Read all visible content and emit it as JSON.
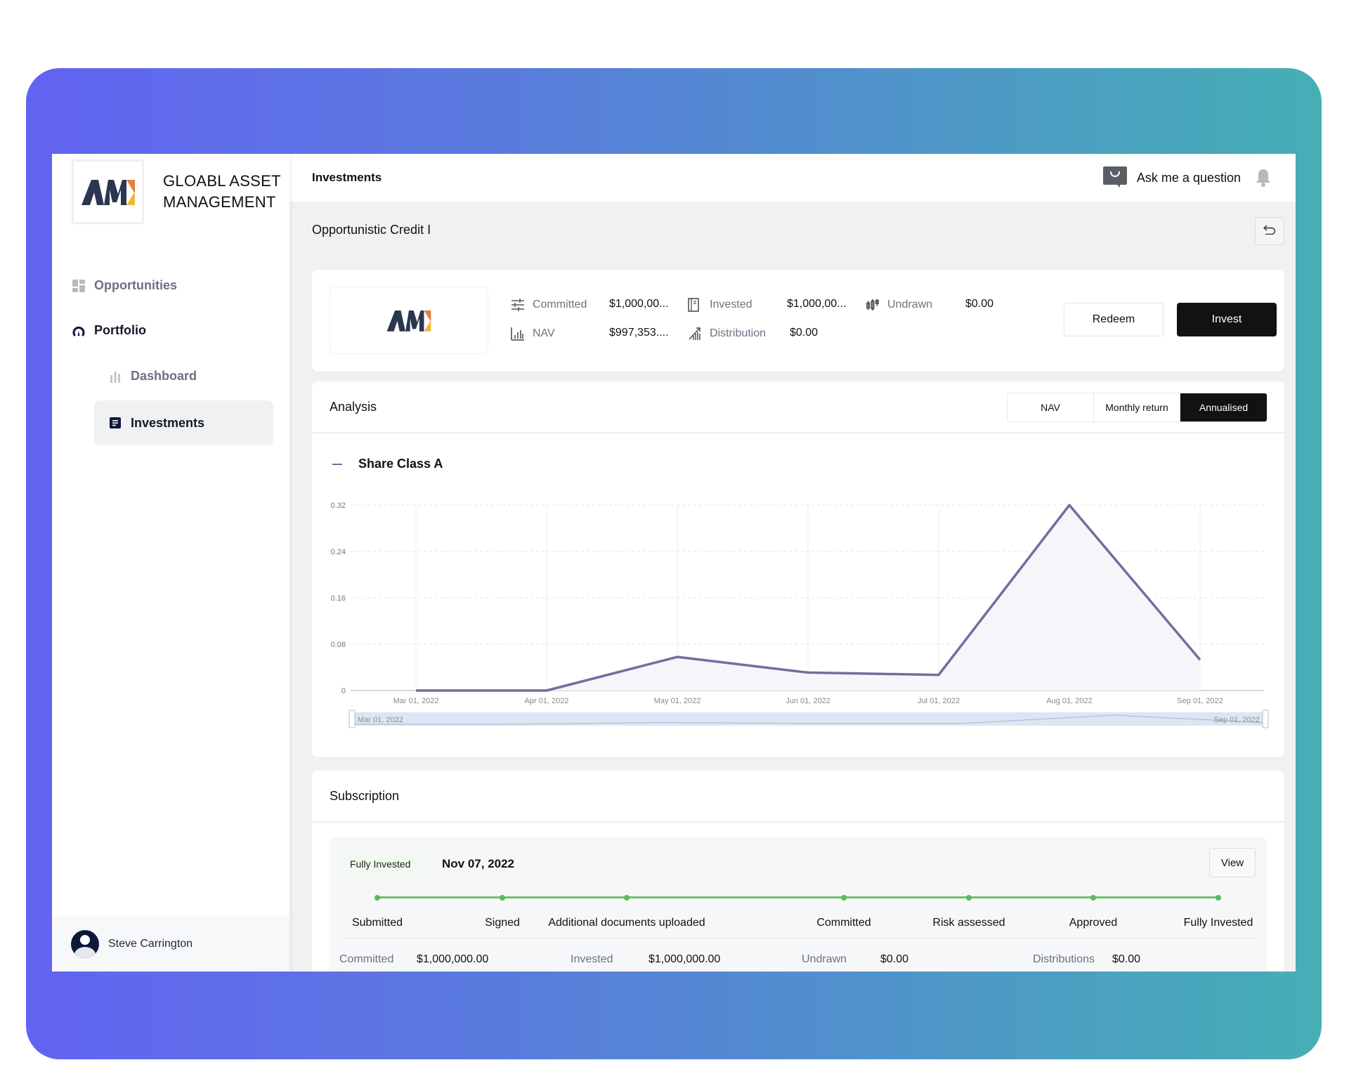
{
  "brand": {
    "name_line1": "GLOABL ASSET",
    "name_line2": "MANAGEMENT",
    "logo_text": "AM"
  },
  "sidebar": {
    "items": [
      {
        "label": "Opportunities",
        "icon": "grid-icon"
      },
      {
        "label": "Portfolio",
        "icon": "gauge-icon"
      },
      {
        "label": "Dashboard",
        "icon": "bar-chart-icon"
      },
      {
        "label": "Investments",
        "icon": "document-icon",
        "active": true
      }
    ],
    "user": {
      "name": "Steve Carrington"
    }
  },
  "header": {
    "title": "Investments",
    "ask_label": "Ask me a question"
  },
  "fund": {
    "title": "Opportunistic Credit I",
    "metrics": [
      {
        "label": "Committed",
        "value": "$1,000,00...",
        "icon": "sliders-icon"
      },
      {
        "label": "Invested",
        "value": "$1,000,00...",
        "icon": "book-icon"
      },
      {
        "label": "Undrawn",
        "value": "$0.00",
        "icon": "candlestick-icon"
      },
      {
        "label": "NAV",
        "value": "$997,353....",
        "icon": "bar-chart-icon"
      },
      {
        "label": "Distribution",
        "value": "$0.00",
        "icon": "signal-icon"
      }
    ],
    "actions": {
      "redeem": "Redeem",
      "invest": "Invest"
    }
  },
  "analysis": {
    "title": "Analysis",
    "tabs": [
      {
        "label": "NAV",
        "active": false
      },
      {
        "label": "Monthly return",
        "active": false
      },
      {
        "label": "Annualised",
        "active": true
      }
    ],
    "range": {
      "start": "Mar 01, 2022",
      "end": "Sep 01, 2022"
    }
  },
  "chart_data": {
    "type": "area",
    "title": "",
    "legend": [
      {
        "name": "Share Class A",
        "color": "#7a6a9e"
      }
    ],
    "legend_position": "top-left",
    "categories": [
      "Mar 01, 2022",
      "Apr 01, 2022",
      "May 01, 2022",
      "Jun 01, 2022",
      "Jul 01, 2022",
      "Aug 01, 2022",
      "Sep 01, 2022"
    ],
    "series": [
      {
        "name": "Share Class A",
        "values": [
          0,
          0,
          0.058,
          0.031,
          0.027,
          0.32,
          0.053
        ]
      }
    ],
    "yticks": [
      0,
      0.08,
      0.16,
      0.24,
      0.32
    ],
    "ytick_labels": [
      "0",
      "0.08",
      "0.16",
      "0.24",
      "0.32"
    ],
    "ylim": [
      0,
      0.32
    ],
    "xlabel": "",
    "ylabel": "",
    "grid": true,
    "colors": {
      "line": "#7a6a9e",
      "area": "#f5f5f9",
      "grid": "#e3e5ea"
    }
  },
  "subscription": {
    "title": "Subscription",
    "status": "Fully Invested",
    "date": "Nov 07, 2022",
    "view_label": "View",
    "steps": [
      "Submitted",
      "Signed",
      "Additional documents uploaded",
      "Committed",
      "Risk assessed",
      "Approved",
      "Fully Invested"
    ],
    "completed_steps": 7,
    "stats": [
      {
        "label": "Committed",
        "value": "$1,000,000.00"
      },
      {
        "label": "Invested",
        "value": "$1,000,000.00"
      },
      {
        "label": "Undrawn",
        "value": "$0.00"
      },
      {
        "label": "Distributions",
        "value": "$0.00"
      }
    ]
  },
  "colors": {
    "accent_dark": "#111214",
    "success": "#5db85d",
    "gradient_start": "#6263F2",
    "gradient_end": "#45AFB5"
  }
}
